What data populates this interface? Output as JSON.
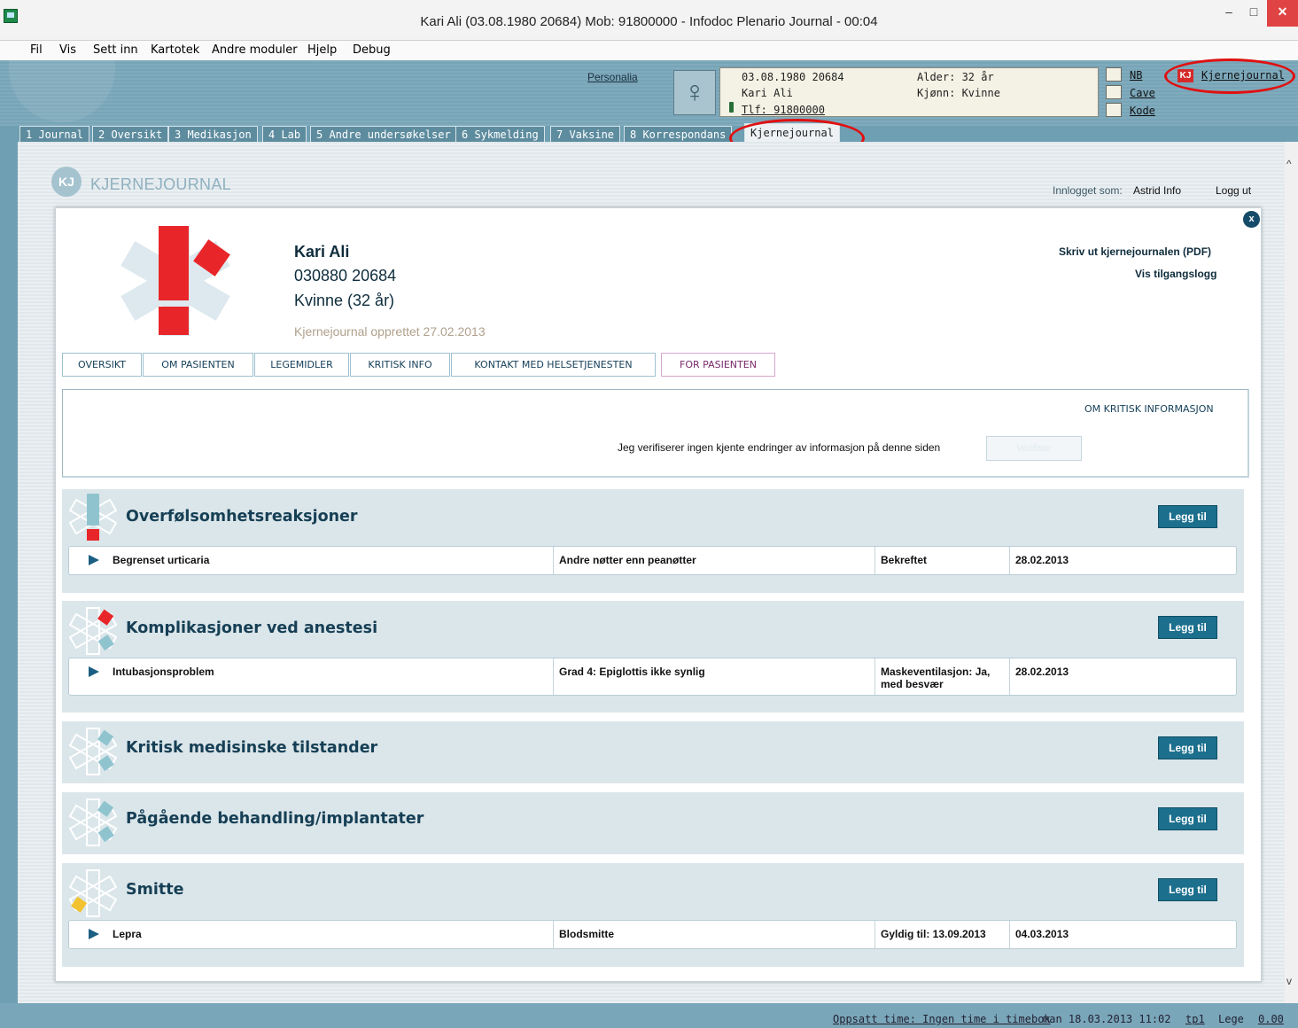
{
  "window": {
    "title": "Kari Ali (03.08.1980 20684) Mob: 91800000 - Infodoc Plenario Journal - 00:04",
    "minimize": "–",
    "maximize": "□",
    "close": "✕"
  },
  "menubar": {
    "items": [
      "Fil",
      "Vis",
      "Sett inn",
      "Kartotek",
      "Andre moduler",
      "Hjelp",
      "Debug"
    ]
  },
  "header": {
    "personalia_link": "Personalia",
    "gender_symbol": "♀",
    "birth_id": "03.08.1980 20684",
    "name": "Kari Ali",
    "phone": "Tlf: 91800000",
    "age": "Alder: 32 år",
    "gender": "Kjønn: Kvinne",
    "flags": [
      "NB",
      "Cave",
      "Kode"
    ],
    "kj_badge": "KJ",
    "kj_link": "Kjernejournal"
  },
  "tabs": [
    "1 Journal",
    "2 Oversikt",
    "3 Medikasjon",
    "4 Lab",
    "5 Andre undersøkelser",
    "6 Sykmelding",
    "7 Vaksine",
    "8 Korrespondans",
    "Kjernejournal"
  ],
  "kj": {
    "logo_badge": "KJ",
    "logo_text": "KJERNEJOURNAL",
    "login_label": "Innlogget som:",
    "login_user": "Astrid Info",
    "logout": "Logg ut",
    "close": "x",
    "patient": {
      "name": "Kari Ali",
      "id": "030880 20684",
      "gender_age": "Kvinne (32 år)",
      "created": "Kjernejournal opprettet 27.02.2013"
    },
    "print_link": "Skriv ut kjernejournalen (PDF)",
    "access_log_link": "Vis tilgangslogg",
    "content_tabs": [
      "OVERSIKT",
      "OM PASIENTEN",
      "LEGEMIDLER",
      "KRITISK INFO",
      "KONTAKT MED HELSETJENESTEN",
      "FOR PASIENTEN"
    ],
    "about_critical": "OM KRITISK INFORMASJON",
    "verify_text": "Jeg verifiserer ingen kjente endringer av informasjon på denne siden",
    "verify_button": "Verifiser",
    "add_label": "Legg til",
    "sections": [
      {
        "title": "Overfølsomhetsreaksjoner",
        "icon": "star-exclamation-icon",
        "rows": [
          {
            "c1": "Begrenset urticaria",
            "c2": "Andre nøtter enn peanøtter",
            "c3": "Bekreftet",
            "c4": "28.02.2013"
          }
        ]
      },
      {
        "title": "Komplikasjoner ved anestesi",
        "icon": "star-red-arm-icon",
        "rows": [
          {
            "c1": "Intubasjonsproblem",
            "c2": "Grad 4: Epiglottis ikke synlig",
            "c3": "Maskeventilasjon: Ja, med besvær",
            "c4": "28.02.2013"
          }
        ]
      },
      {
        "title": "Kritisk medisinske tilstander",
        "icon": "star-blue-arm-icon",
        "rows": []
      },
      {
        "title": "Pågående behandling/implantater",
        "icon": "star-blue-arm-icon",
        "rows": []
      },
      {
        "title": "Smitte",
        "icon": "star-yellow-arm-icon",
        "rows": [
          {
            "c1": "Lepra",
            "c2": "Blodsmitte",
            "c3": "Gyldig til: 13.09.2013",
            "c4": "04.03.2013"
          }
        ]
      }
    ]
  },
  "statusbar": {
    "appointment": "Oppsatt time: Ingen time i timebok",
    "datetime": "man 18.03.2013 11:02",
    "user": "tp1",
    "role": "Lege",
    "amount": "0.00"
  },
  "colors": {
    "accent_dark": "#163f55",
    "button_blue": "#1c6f8d",
    "critical_red": "#e8262a",
    "highlight_oval": "#e01010",
    "section_bg": "#dbe6ea"
  }
}
